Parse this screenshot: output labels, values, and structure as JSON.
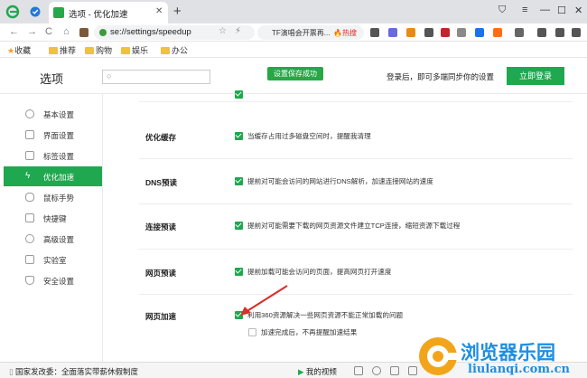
{
  "tab": {
    "title": "选项 - 优化加速",
    "close": "✕"
  },
  "new_tab": "+",
  "window_controls": [
    "⛉",
    "≡",
    "—",
    "☐",
    "✕"
  ],
  "nav": {
    "back": "←",
    "forward": "→",
    "reload": "C",
    "home": "⌂"
  },
  "address": {
    "url": "se://settings/speedup",
    "star": "☆",
    "bolt": "⚡"
  },
  "search": {
    "text": "TF演唱会开票再...",
    "hot": "🔥热搜"
  },
  "bookmarks": [
    "收藏",
    "推荐",
    "购物",
    "娱乐",
    "办公"
  ],
  "settings": {
    "title": "选项",
    "search_placeholder": "",
    "save_toast": "设置保存成功",
    "login_tip": "登录后，即可多端同步你的设置",
    "login_button": "立即登录"
  },
  "sidebar": [
    {
      "label": "基本设置"
    },
    {
      "label": "界面设置"
    },
    {
      "label": "标签设置"
    },
    {
      "label": "优化加速",
      "active": true
    },
    {
      "label": "鼠标手势"
    },
    {
      "label": "快捷键"
    },
    {
      "label": "高级设置"
    },
    {
      "label": "实验室"
    },
    {
      "label": "安全设置"
    }
  ],
  "rows": [
    {
      "label": "优化缓存",
      "options": [
        {
          "text": "当缓存占用过多磁盘空间时，提醒我清理",
          "checked": true
        }
      ]
    },
    {
      "label": "DNS预读",
      "options": [
        {
          "text": "提前对可能会访问的网站进行DNS解析，加速连接网站的速度",
          "checked": true
        }
      ]
    },
    {
      "label": "连接预读",
      "options": [
        {
          "text": "提前对可能需要下载的网页资源文件建立TCP连接，缩短资源下载过程",
          "checked": true
        }
      ]
    },
    {
      "label": "网页预读",
      "options": [
        {
          "text": "提前加载可能会访问的页面，提高网页打开速度",
          "checked": true
        }
      ]
    },
    {
      "label": "网页加速",
      "options": [
        {
          "text": "利用360资源解决一些网页资源不能正常加载的问题",
          "checked": true
        },
        {
          "text": "加速完成后，不再提醒加速结果",
          "checked": false
        }
      ]
    }
  ],
  "statusbar": {
    "news": "国家发改委：全面落实带薪休假制度",
    "my_video": "我的视频"
  },
  "watermark": {
    "title": "浏览器乐园",
    "url": "liulanqi.com.cn"
  },
  "colors": {
    "accent": "#1fa84f",
    "watermark": "#1e8ee0",
    "arrow": "#d9312b"
  }
}
